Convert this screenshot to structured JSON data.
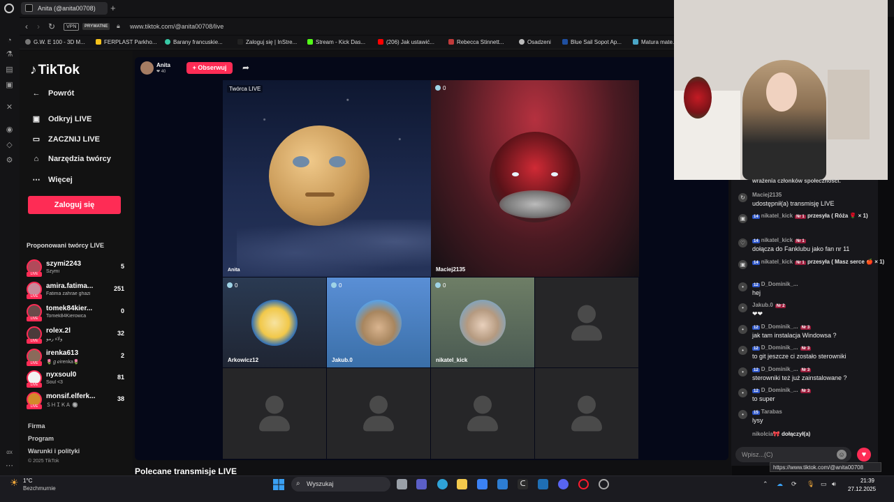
{
  "browser": {
    "tab_title": "Anita (@anita00708)",
    "url": "www.tiktok.com/@anita00708/live",
    "vpn_label": "VPN",
    "private_label": "PRYWATNE",
    "bookmarks": [
      "G.W. E 100 - 3D M...",
      "FERPLAST Parkho...",
      "Barany francuskie...",
      "Zaloguj się | InStre...",
      "Stream - Kick Das...",
      "(206) Jak ustawić...",
      "Rebecca Stinnett...",
      "Osadzeni",
      "Blue Sail Sopot Ap...",
      "Matura mate..."
    ]
  },
  "sidebar": {
    "logo": "TikTok",
    "back": "Powrót",
    "items": [
      "Odkryj LIVE",
      "ZACZNIJ LIVE",
      "Narzędzia twórcy",
      "Więcej"
    ],
    "login": "Zaloguj się",
    "suggested_title": "Proponowani twórcy LIVE",
    "creators": [
      {
        "name": "szymi2243",
        "sub": "Szymi",
        "count": "5",
        "color": "#b04a5a"
      },
      {
        "name": "amira.fatima...",
        "sub": "Fatima zahrae ghazi",
        "count": "251",
        "color": "#c98a9a"
      },
      {
        "name": "tomek84kier...",
        "sub": "Tomek84Kierowca",
        "count": "0",
        "color": "#6b4a4a"
      },
      {
        "name": "rolex.2l",
        "sub": "ولاء رمو",
        "count": "32",
        "color": "#4a3a3a"
      },
      {
        "name": "irenka613",
        "sub": "🌷ℊℯirenka🌷",
        "count": "2",
        "color": "#8a6a5a"
      },
      {
        "name": "nyxsoul0",
        "sub": "Soul <3",
        "count": "81",
        "color": "#f2f2f2"
      },
      {
        "name": "monsif.elferk...",
        "sub": "ＳＨＩＫＡ 🔘",
        "count": "38",
        "color": "#d48a2a"
      }
    ],
    "footer": [
      "Firma",
      "Program",
      "Warunki i polityki"
    ],
    "copyright": "© 2025 TikTok"
  },
  "live": {
    "host_name": "Anita",
    "host_likes": "❤ 40",
    "follow": "+ Obserwuj",
    "tiles": [
      {
        "label": "Anita",
        "badge": "Twórca LIVE"
      },
      {
        "label": "Maciej2135",
        "badge": "0"
      },
      {
        "label": "Arkowicz12",
        "badge": "0"
      },
      {
        "label": "Jakub.0",
        "badge": "0"
      },
      {
        "label": "nikatel_kick",
        "badge": "0"
      }
    ],
    "recommended": "Polecane transmisje LIVE"
  },
  "chat": {
    "top_fragment": "wrażenia członków społeczności.",
    "messages": [
      {
        "user": "Maciej2135",
        "level": "",
        "fan": "",
        "text": "udostępnił(a) transmisję LIVE",
        "icon": "share-icon"
      },
      {
        "user": "nikatel_kick",
        "level": "14",
        "fan": "Nr 1",
        "text": "przesyła ( Róża 🌹 × 1)",
        "icon": "gift-icon"
      },
      {
        "user": "nikatel_kick",
        "level": "14",
        "fan": "Nr 1",
        "text": "dołącza do Fanklubu jako fan nr 11",
        "icon": "heart-outline-icon"
      },
      {
        "user": "nikatel_kick",
        "level": "14",
        "fan": "Nr 1",
        "text": "przesyła ( Masz serce 🍎 × 1)",
        "icon": "gift-icon"
      },
      {
        "user": "D_Dominik_...",
        "level": "12",
        "fan": "",
        "text": "hej",
        "icon": "avatar-icon"
      },
      {
        "user": "Jakub.0",
        "level": "",
        "fan": "Nr 2",
        "text": "❤❤",
        "icon": "avatar-icon"
      },
      {
        "user": "D_Dominik_...",
        "level": "12",
        "fan": "Nr 3",
        "text": "jak tam instalacja Windowsa ?",
        "icon": "avatar-icon"
      },
      {
        "user": "D_Dominik_...",
        "level": "12",
        "fan": "Nr 3",
        "text": "to git jeszcze ci zostało sterowniki",
        "icon": "avatar-icon"
      },
      {
        "user": "D_Dominik_...",
        "level": "12",
        "fan": "Nr 3",
        "text": "sterowniki też już zainstalowane ?",
        "icon": "avatar-icon"
      },
      {
        "user": "D_Dominik_...",
        "level": "12",
        "fan": "Nr 3",
        "text": "to super",
        "icon": "avatar-icon"
      },
      {
        "user": "Tarabas",
        "level": "15",
        "fan": "",
        "text": "lysy",
        "icon": "avatar-icon"
      },
      {
        "user": "nikolcia🎀",
        "level": "",
        "fan": "",
        "text": "dołączył(a)",
        "icon": ""
      }
    ],
    "input_placeholder": "Wpisz...(C)",
    "tooltip": "https://www.tiktok.com/@anita00708"
  },
  "taskbar": {
    "temp": "1°C",
    "weather": "Bezchmurnie",
    "search": "Wyszukaj",
    "time": "21:39",
    "date": "27.12.2025"
  }
}
